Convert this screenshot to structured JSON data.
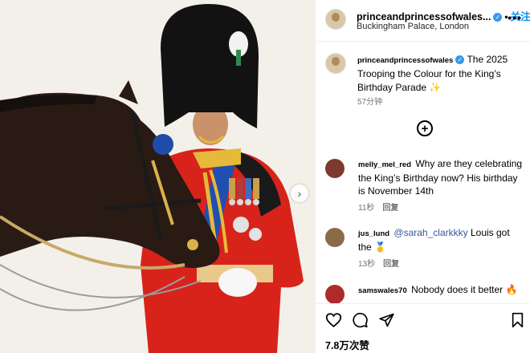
{
  "header": {
    "username": "princeandprincessofwales",
    "username_display": "princeandprincessofwales...",
    "follow_label": "关注",
    "separator": "•",
    "location": "Buckingham Palace, London",
    "more_icon": "more-horizontal-icon"
  },
  "caption": {
    "username": "princeandprincessofwales",
    "text": "The 2025 Trooping the Colour for the King’s Birthday Parade",
    "emoji": "✨",
    "time": "57分钟"
  },
  "add_comment_icon": "plus-circle-icon",
  "comments": [
    {
      "username": "melly_mel_red",
      "text": "Why are they celebrating the King’s Birthday now? His birthday is November 14th",
      "time": "11秒",
      "reply_label": "回复"
    },
    {
      "username": "jus_lund",
      "mention": "@sarah_clarkkky",
      "text": "Louis got the",
      "emoji": "🥇",
      "time": "13秒",
      "reply_label": "回复"
    },
    {
      "username": "samswales70",
      "text": "Nobody does it better",
      "emoji": "🔥"
    }
  ],
  "actions": {
    "like_icon": "heart-icon",
    "comment_icon": "comment-icon",
    "share_icon": "send-icon",
    "save_icon": "bookmark-icon"
  },
  "likes_label": "7.8万次赞",
  "colors": {
    "follow_blue": "#0095f6",
    "verified_blue": "#3897f0",
    "mention_blue": "#385898",
    "meta_gray": "#737373",
    "tunic_red": "#d8231a"
  }
}
